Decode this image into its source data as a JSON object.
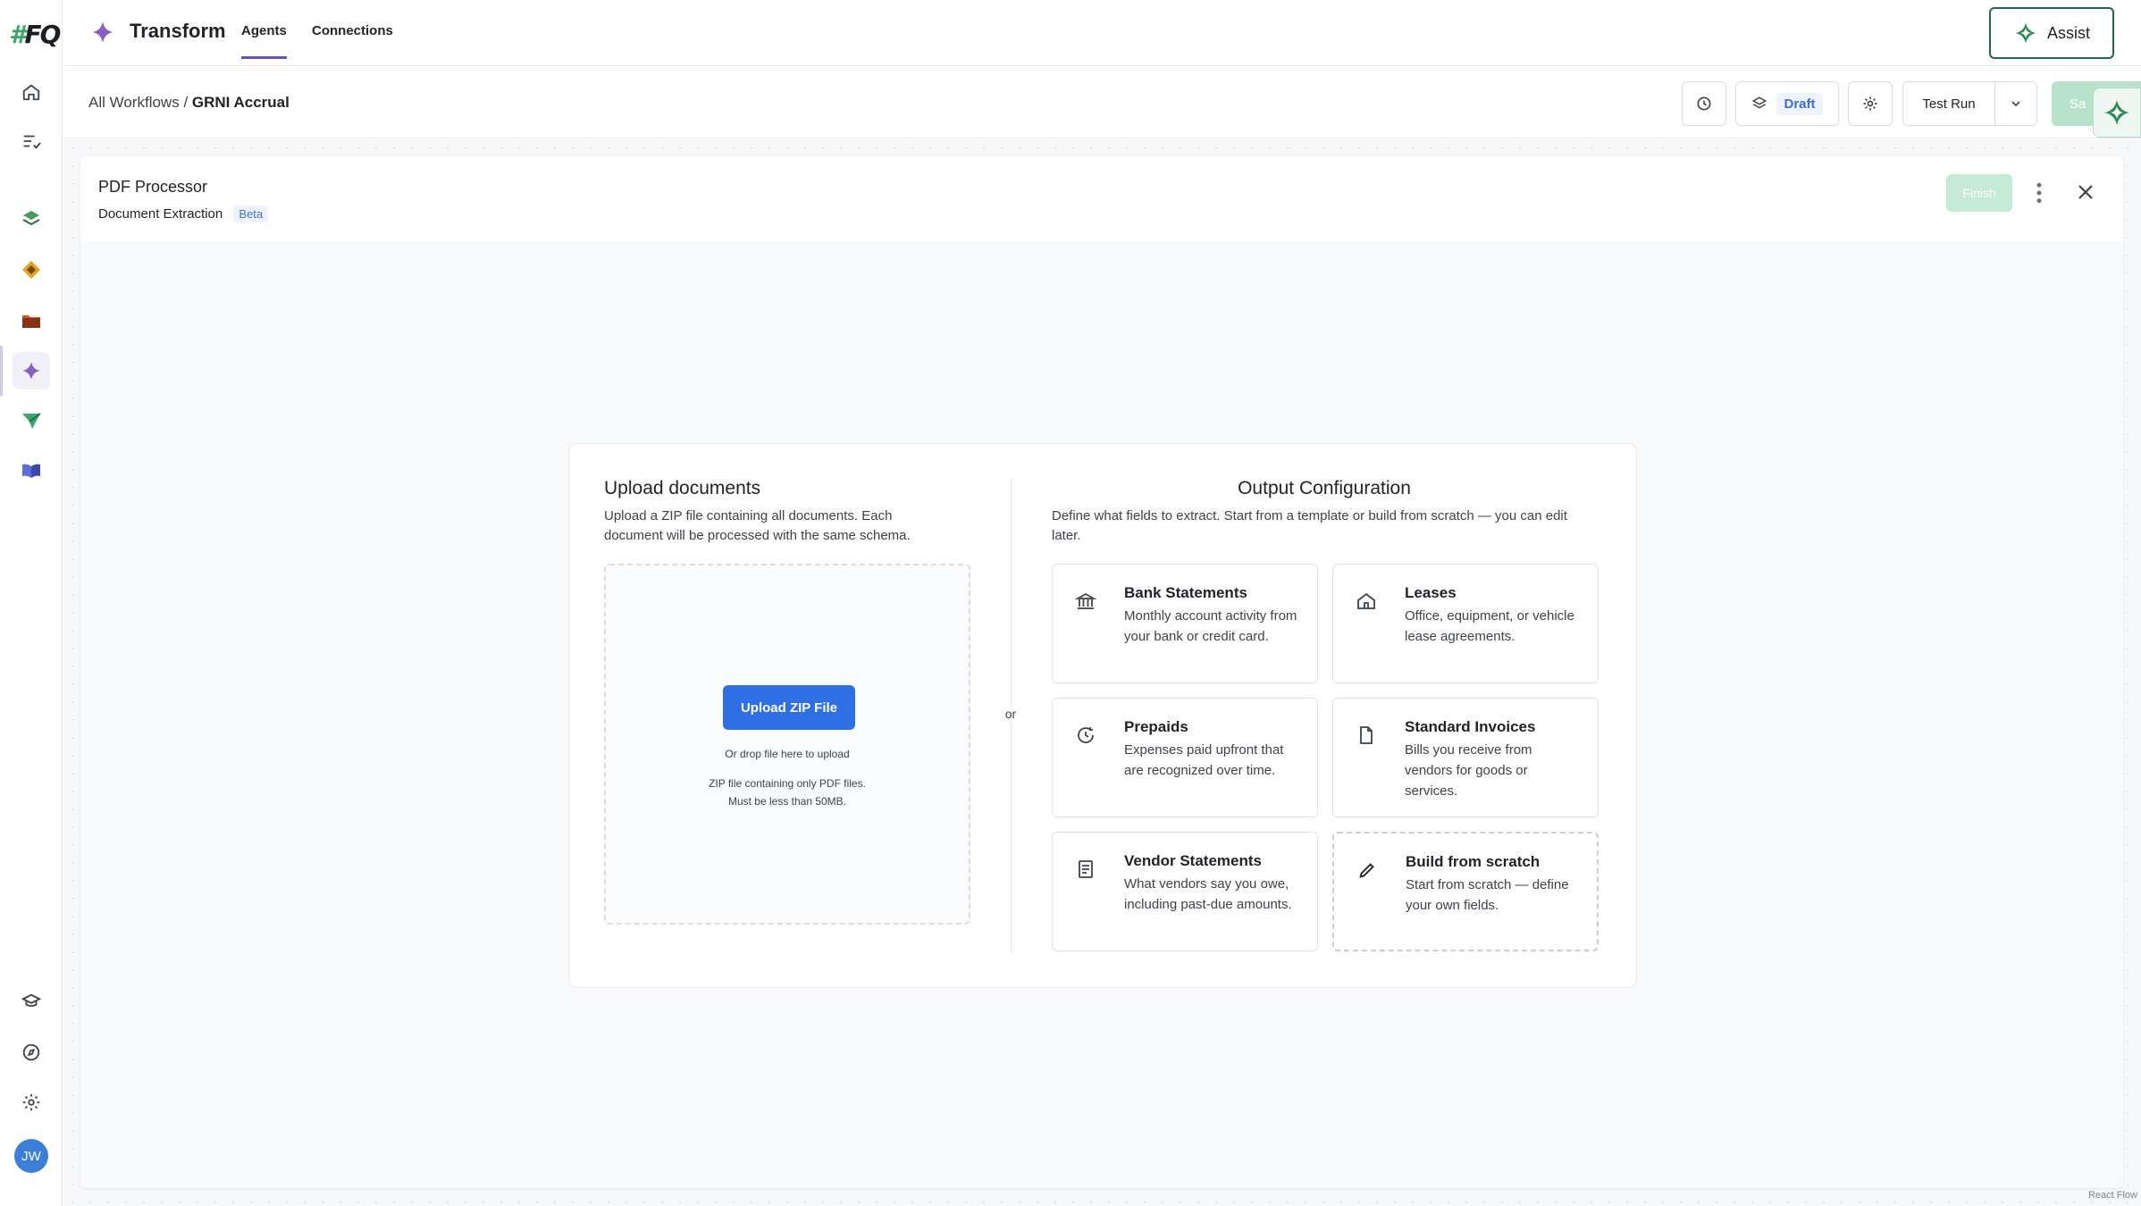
{
  "app": {
    "logo_text": "#FQ",
    "title": "Transform",
    "tabs": [
      {
        "label": "Agents",
        "active": true
      },
      {
        "label": "Connections",
        "active": false
      }
    ],
    "assist_label": "Assist"
  },
  "sidebar": {
    "items": [
      {
        "icon": "home-icon"
      },
      {
        "icon": "tasks-icon"
      },
      {
        "icon": "layers-icon"
      },
      {
        "icon": "diamond-icon"
      },
      {
        "icon": "folder-icon"
      },
      {
        "icon": "sparkle-icon",
        "active": true
      },
      {
        "icon": "send-icon"
      },
      {
        "icon": "book-icon"
      }
    ],
    "bottom": [
      {
        "icon": "graduation-cap-icon"
      },
      {
        "icon": "compass-icon"
      },
      {
        "icon": "settings-icon"
      }
    ],
    "avatar_initials": "JW"
  },
  "breadcrumb": {
    "parent": "All Workflows",
    "separator": "/",
    "current": "GRNI Accrual"
  },
  "toolbar": {
    "status": "Draft",
    "test_run_label": "Test Run",
    "save_label": "Sa"
  },
  "panel": {
    "title": "PDF Processor",
    "subtitle": "Document Extraction",
    "badge": "Beta",
    "finish_label": "Finish"
  },
  "upload": {
    "title": "Upload documents",
    "description": "Upload a ZIP file containing all documents. Each document will be processed with the same schema.",
    "button_label": "Upload ZIP File",
    "drop_hint": "Or drop file here to upload",
    "rule_line1": "ZIP file containing only PDF files.",
    "rule_line2": "Must be less than 50MB."
  },
  "or_label": "or",
  "output_config": {
    "title": "Output Configuration",
    "description": "Define what fields to extract. Start from a template or build from scratch — you can edit later.",
    "templates": [
      {
        "icon": "bank-icon",
        "title": "Bank Statements",
        "description": "Monthly account activity from your bank or credit card."
      },
      {
        "icon": "house-icon",
        "title": "Leases",
        "description": "Office, equipment, or vehicle lease agreements."
      },
      {
        "icon": "clock-refresh-icon",
        "title": "Prepaids",
        "description": "Expenses paid upfront that are recognized over time."
      },
      {
        "icon": "document-icon",
        "title": "Standard Invoices",
        "description": "Bills you receive from vendors for goods or services."
      },
      {
        "icon": "list-doc-icon",
        "title": "Vendor Statements",
        "description": "What vendors say you owe, including past-due amounts."
      },
      {
        "icon": "pencil-icon",
        "title": "Build from scratch",
        "description": "Start from scratch — define your own fields."
      }
    ]
  },
  "footer_credit": "React Flow",
  "colors": {
    "accent_purple": "#6b4fbf",
    "brand_green": "#1f6b47",
    "primary_blue": "#2f6fe4"
  }
}
